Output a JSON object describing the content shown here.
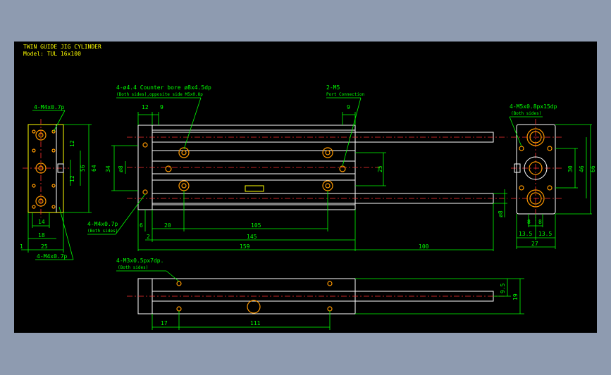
{
  "title": "TWIN GUIDE JIG CYLINDER",
  "model": "Model: TUL 16x100",
  "callouts": {
    "counterbore": "4-ø4.4 Counter bore ø8x4.5dp",
    "counterbore_sub": "(Both sides),opposite side M5x0.8p",
    "port": "2-M5",
    "port_sub": "Port Connection",
    "left_top": "4-M4x0.7p",
    "left_bottom": "4-M4x0.7p",
    "front_left": "4-M4x0.7p",
    "front_left_sub": "(Both sides)",
    "right_top": "4-M5x0.8px15dp",
    "right_top_sub": "(Both sides)",
    "bottom_top": "4-M3x0.5px7dp.",
    "bottom_top_sub": "(Both sides)"
  },
  "dims": {
    "left_14": "14",
    "left_18": "18",
    "left_25": "25",
    "left_1": "1",
    "left_12a": "12",
    "left_12b": "12",
    "left_56": "56",
    "left_64": "64",
    "front_12": "12",
    "front_9": "9",
    "front_9b": "9",
    "front_34": "34",
    "front_d8": "ø8",
    "front_25": "25",
    "front_d8b": "ø8",
    "front_6": "6",
    "front_2": "2",
    "front_20": "20",
    "front_105": "105",
    "front_145": "145",
    "front_159": "159",
    "front_100": "100",
    "right_30": "30",
    "right_46": "46",
    "right_66": "66",
    "right_8a": "8",
    "right_8b": "8",
    "right_135a": "13.5",
    "right_135b": "13.5",
    "right_27": "27",
    "bottom_17": "17",
    "bottom_111": "111",
    "bottom_95": "9.5",
    "bottom_19": "19"
  },
  "colors": {
    "background": "#000000",
    "frame": "#8e9bb0",
    "outline": "#ffffff",
    "dimension": "#00ff00",
    "centerline": "#ff3030",
    "text": "#ffff00",
    "hole": "#ff9900"
  }
}
